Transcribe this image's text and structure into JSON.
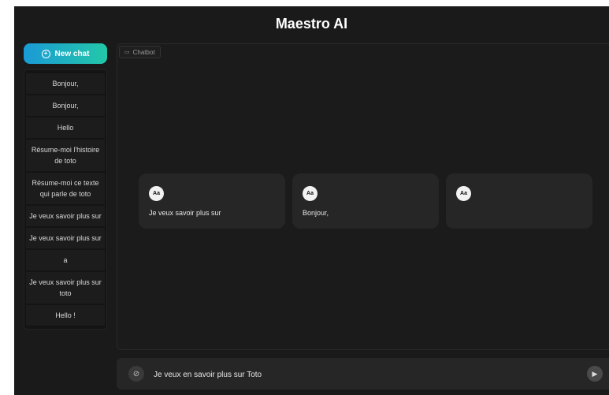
{
  "app": {
    "title": "Maestro AI"
  },
  "sidebar": {
    "new_chat_label": "New chat",
    "history": [
      "Bonjour,",
      "Bonjour,",
      "Hello",
      "Résume-moi l'histoire de toto",
      "Résume-moi ce texte qui parle de toto",
      "Je veux savoir plus sur",
      "Je veux savoir plus sur",
      "a",
      "Je veux savoir plus sur toto",
      "Hello !"
    ]
  },
  "chat": {
    "tag_label": "Chatbot",
    "cards": [
      {
        "avatar": "Aa",
        "text": "Je veux savoir plus sur"
      },
      {
        "avatar": "Aa",
        "text": "Bonjour,"
      },
      {
        "avatar": "Aa",
        "text": ""
      }
    ]
  },
  "input": {
    "value": "Je veux en savoir plus sur Toto",
    "attach_icon": "paperclip-icon",
    "send_icon": "send-icon"
  },
  "colors": {
    "background": "#1a1a1a",
    "accent_start": "#1a9ad6",
    "accent_end": "#23c8a8"
  }
}
